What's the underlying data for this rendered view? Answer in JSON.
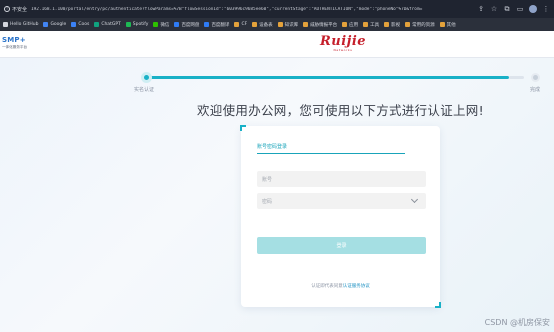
{
  "browser": {
    "security_warning": "不安全",
    "url": "192.168.1.100/portal/entry/pc/authenticate?flowParams=%7B\"flowSessionId\":\"603996c9685ee60\",\"currentStage\":\"AUTHENTICATION\",\"mode\":\"phoneNo\"%7D&from="
  },
  "bookmarks": [
    {
      "label": "Hello GitHub",
      "color": "#d4d7de"
    },
    {
      "label": "Google",
      "color": "#4285f4"
    },
    {
      "label": "Coos",
      "color": "#3b82f6"
    },
    {
      "label": "ChatGPT",
      "color": "#10a37f"
    },
    {
      "label": "Spotify",
      "color": "#1db954"
    },
    {
      "label": "微信",
      "color": "#2dc100"
    },
    {
      "label": "百度网盘",
      "color": "#2f7cf6"
    },
    {
      "label": "百度翻译",
      "color": "#2f7cf6"
    },
    {
      "label": "CF",
      "color": "#e4a23b"
    },
    {
      "label": "设备表",
      "color": "#e4a23b"
    },
    {
      "label": "知识库",
      "color": "#e4a23b"
    },
    {
      "label": "威胁情报平台",
      "color": "#e4a23b"
    },
    {
      "label": "应用",
      "color": "#e4a23b"
    },
    {
      "label": "工具",
      "color": "#e4a23b"
    },
    {
      "label": "影视",
      "color": "#e4a23b"
    },
    {
      "label": "常用的资源",
      "color": "#e4a23b"
    },
    {
      "label": "其他",
      "color": "#e4a23b"
    }
  ],
  "header": {
    "brand_name": "SMP+",
    "brand_sub": "一体化服务平台",
    "logo_text": "Ruijie",
    "logo_sub": "Networks"
  },
  "stepper": {
    "step1_label": "实名认证",
    "step2_label": "完成",
    "progress": 0.96
  },
  "main": {
    "heading": "欢迎使用办公网，您可使用以下方式进行认证上网!"
  },
  "login": {
    "tab_label": "账号密码登录",
    "account_placeholder": "账号",
    "password_placeholder": "密码",
    "button_label": "登录",
    "agree_prefix": "认证即代表同意",
    "agree_link": "认证服务协议"
  },
  "watermark": "CSDN @机房保安",
  "colors": {
    "accent": "#19b1c7",
    "button": "#a5dfe3",
    "logo": "#c51e2a"
  }
}
